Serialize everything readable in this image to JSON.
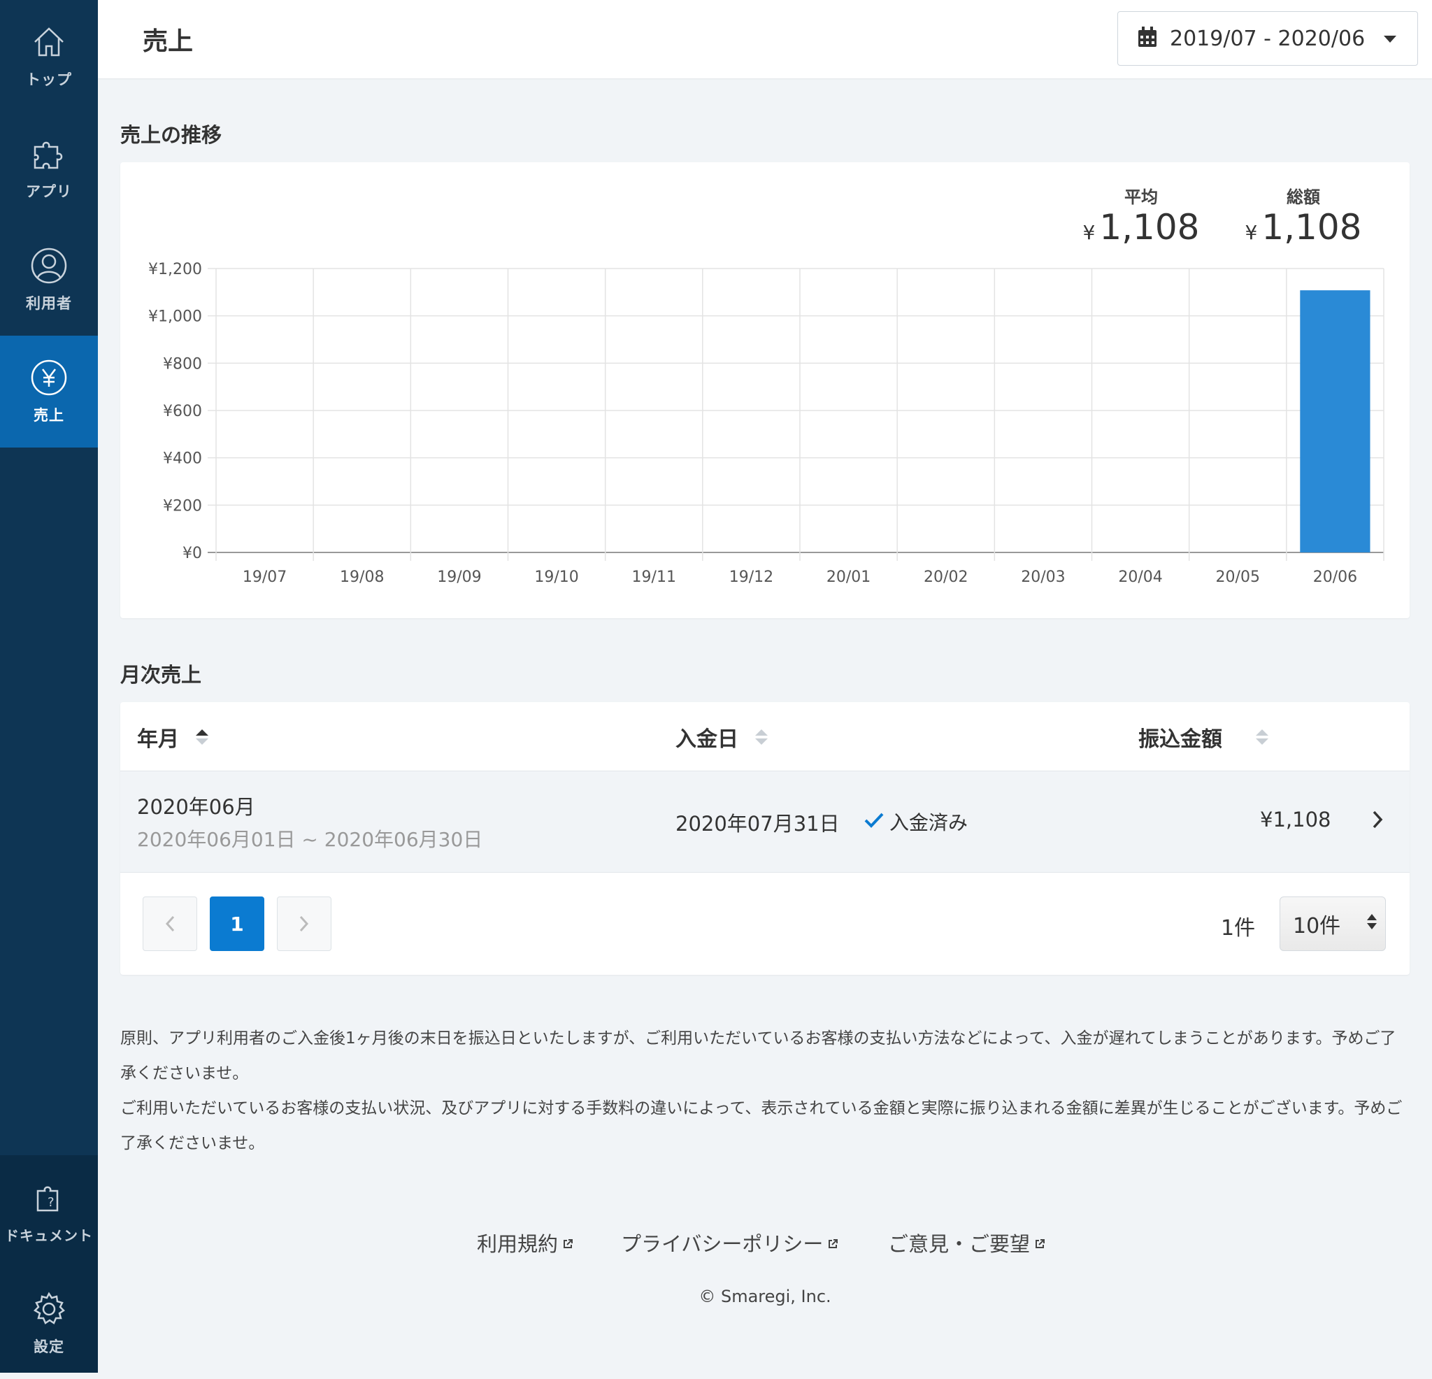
{
  "sidebar": {
    "items": [
      {
        "label": "トップ",
        "icon": "home-icon"
      },
      {
        "label": "アプリ",
        "icon": "puzzle-icon"
      },
      {
        "label": "利用者",
        "icon": "user-icon"
      },
      {
        "label": "売上",
        "icon": "yen-icon"
      }
    ],
    "bottom": [
      {
        "label": "ドキュメント",
        "icon": "document-help-icon"
      },
      {
        "label": "設定",
        "icon": "gear-icon"
      }
    ]
  },
  "header": {
    "title": "売上",
    "date_range": "2019/07 - 2020/06"
  },
  "chart_section": {
    "title": "売上の推移",
    "avg_label": "平均",
    "avg_yen": "¥",
    "avg_value": "1,108",
    "total_label": "総額",
    "total_yen": "¥",
    "total_value": "1,108"
  },
  "chart_data": {
    "type": "bar",
    "categories": [
      "19/07",
      "19/08",
      "19/09",
      "19/10",
      "19/11",
      "19/12",
      "20/01",
      "20/02",
      "20/03",
      "20/04",
      "20/05",
      "20/06"
    ],
    "values": [
      0,
      0,
      0,
      0,
      0,
      0,
      0,
      0,
      0,
      0,
      0,
      1108
    ],
    "ylim": [
      0,
      1200
    ],
    "yticks": [
      0,
      200,
      400,
      600,
      800,
      1000,
      1200
    ],
    "ytick_labels": [
      "¥0",
      "¥200",
      "¥400",
      "¥600",
      "¥800",
      "¥1,000",
      "¥1,200"
    ],
    "grid": true,
    "color": "#2a8ad6"
  },
  "monthly": {
    "title": "月次売上",
    "columns": [
      "年月",
      "入金日",
      "振込金額"
    ],
    "rows": [
      {
        "month": "2020年06月",
        "period": "2020年06月01日 ~ 2020年06月30日",
        "deposit_date": "2020年07月31日",
        "status": "入金済み",
        "amount": "¥1,108"
      }
    ],
    "pagination": {
      "current": "1",
      "count_label": "1件",
      "per_page": "10件"
    }
  },
  "notes": [
    "原則、アプリ利用者のご入金後1ヶ月後の末日を振込日といたしますが、ご利用いただいているお客様の支払い方法などによって、入金が遅れてしまうことがあります。予めご了承くださいませ。",
    "ご利用いただいているお客様の支払い状況、及びアプリに対する手数料の違いによって、表示されている金額と実際に振り込まれる金額に差異が生じることがございます。予めご了承くださいませ。"
  ],
  "footer": {
    "links": [
      "利用規約",
      "プライバシーポリシー",
      "ご意見・ご要望"
    ],
    "copyright": "© Smaregi, Inc."
  },
  "colors": {
    "sidebar": "#0e3554",
    "sidebar_active": "#0b67ae",
    "accent": "#0b7bd1",
    "bar": "#2a8ad6"
  }
}
